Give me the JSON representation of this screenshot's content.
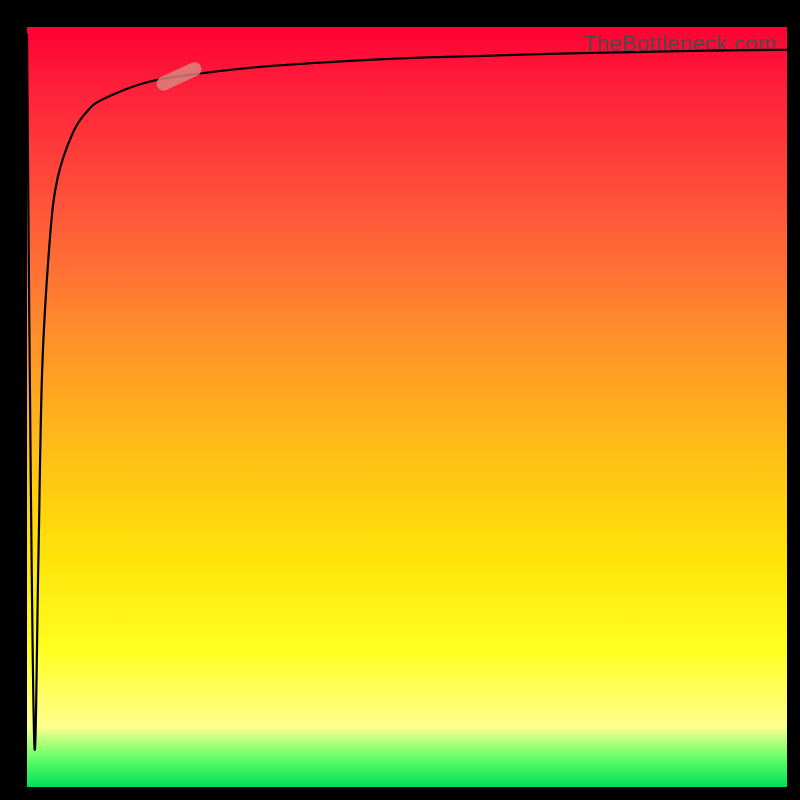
{
  "attribution": "TheBottleneck.com",
  "colors": {
    "frame": "#000000",
    "curve": "#000000",
    "marker_fill": "#d98880",
    "marker_stroke": "#c97a70",
    "gradient_top": "#ff0033",
    "gradient_mid": "#ffe409",
    "gradient_bottom": "#00e05a"
  },
  "chart_data": {
    "type": "line",
    "title": "",
    "xlabel": "",
    "ylabel": "",
    "xlim": [
      0,
      100
    ],
    "ylim": [
      0,
      100
    ],
    "grid": false,
    "legend": false,
    "series": [
      {
        "name": "curve",
        "x": [
          0,
          0.5,
          1,
          1.5,
          2,
          3,
          4,
          6,
          8,
          10,
          15,
          20,
          30,
          40,
          50,
          60,
          70,
          80,
          90,
          100
        ],
        "y": [
          99,
          40,
          5,
          30,
          55,
          72,
          80,
          86,
          89,
          90.5,
          92.5,
          93.5,
          94.7,
          95.4,
          95.9,
          96.2,
          96.5,
          96.7,
          96.9,
          97
        ]
      }
    ],
    "marker": {
      "x": 20,
      "y": 93.5,
      "angle_deg": -25,
      "length": 6
    },
    "notes": "Background is a vertical gradient from red (top) through orange/yellow to green (bottom). Curve dips sharply near x≈1 then rises asymptotically toward ~97. A soft rounded marker highlights a point near x≈20 on the curve."
  }
}
